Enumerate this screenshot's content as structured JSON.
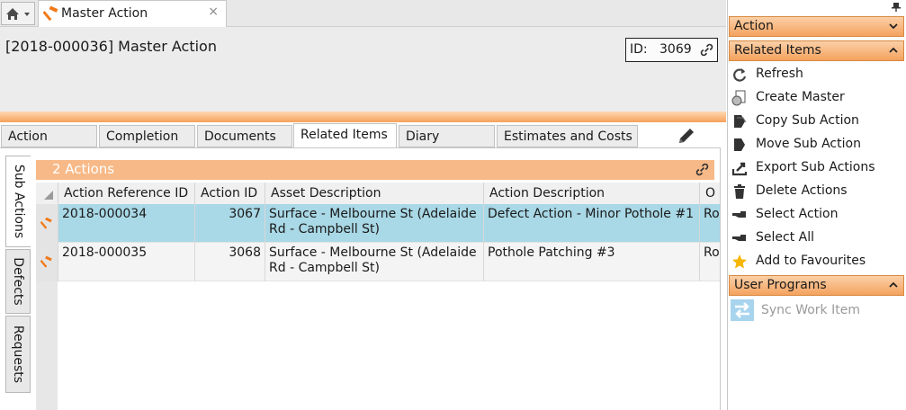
{
  "doc_tab": {
    "title": "Master Action",
    "close": "×"
  },
  "record": {
    "title": "[2018-000036] Master Action",
    "id_label": "ID:",
    "id_value": "3069"
  },
  "tabs": [
    {
      "label": "Action"
    },
    {
      "label": "Completion"
    },
    {
      "label": "Documents"
    },
    {
      "label": "Related Items"
    },
    {
      "label": "Diary"
    },
    {
      "label": "Estimates and Costs"
    }
  ],
  "side_tabs": [
    {
      "label": "Sub Actions"
    },
    {
      "label": "Defects"
    },
    {
      "label": "Requests"
    }
  ],
  "grid": {
    "count_label": "2 Actions",
    "columns": [
      "Action Reference ID",
      "Action ID",
      "Asset Description",
      "Action Description",
      "O"
    ],
    "rows": [
      {
        "ref": "2018-000034",
        "id": "3067",
        "asset": "Surface - Melbourne St (Adelaide Rd - Campbell St)",
        "desc": "Defect Action - Minor Pothole #1",
        "o": "Ro"
      },
      {
        "ref": "2018-000035",
        "id": "3068",
        "asset": "Surface - Melbourne St (Adelaide Rd - Campbell St)",
        "desc": "Pothole Patching #3",
        "o": "Ro"
      }
    ]
  },
  "panel": {
    "action_header": "Action",
    "related_header": "Related Items",
    "related_items": [
      {
        "label": "Refresh",
        "icon": "refresh-icon"
      },
      {
        "label": "Create Master",
        "icon": "create-master-icon"
      },
      {
        "label": "Copy Sub Action",
        "icon": "copy-icon"
      },
      {
        "label": "Move Sub Action",
        "icon": "move-icon"
      },
      {
        "label": "Export Sub Actions",
        "icon": "export-icon"
      },
      {
        "label": "Delete Actions",
        "icon": "trash-icon"
      },
      {
        "label": "Select Action",
        "icon": "pointing-hand-icon"
      },
      {
        "label": "Select All",
        "icon": "pointing-hand-icon"
      },
      {
        "label": "Add to Favourites",
        "icon": "star-icon"
      }
    ],
    "user_programs_header": "User Programs",
    "sync_label": "Sync Work Item"
  },
  "colors": {
    "accent_orange": "#f4a25e",
    "selected_row": "#a9d8e6",
    "count_bar": "#f7b987"
  }
}
